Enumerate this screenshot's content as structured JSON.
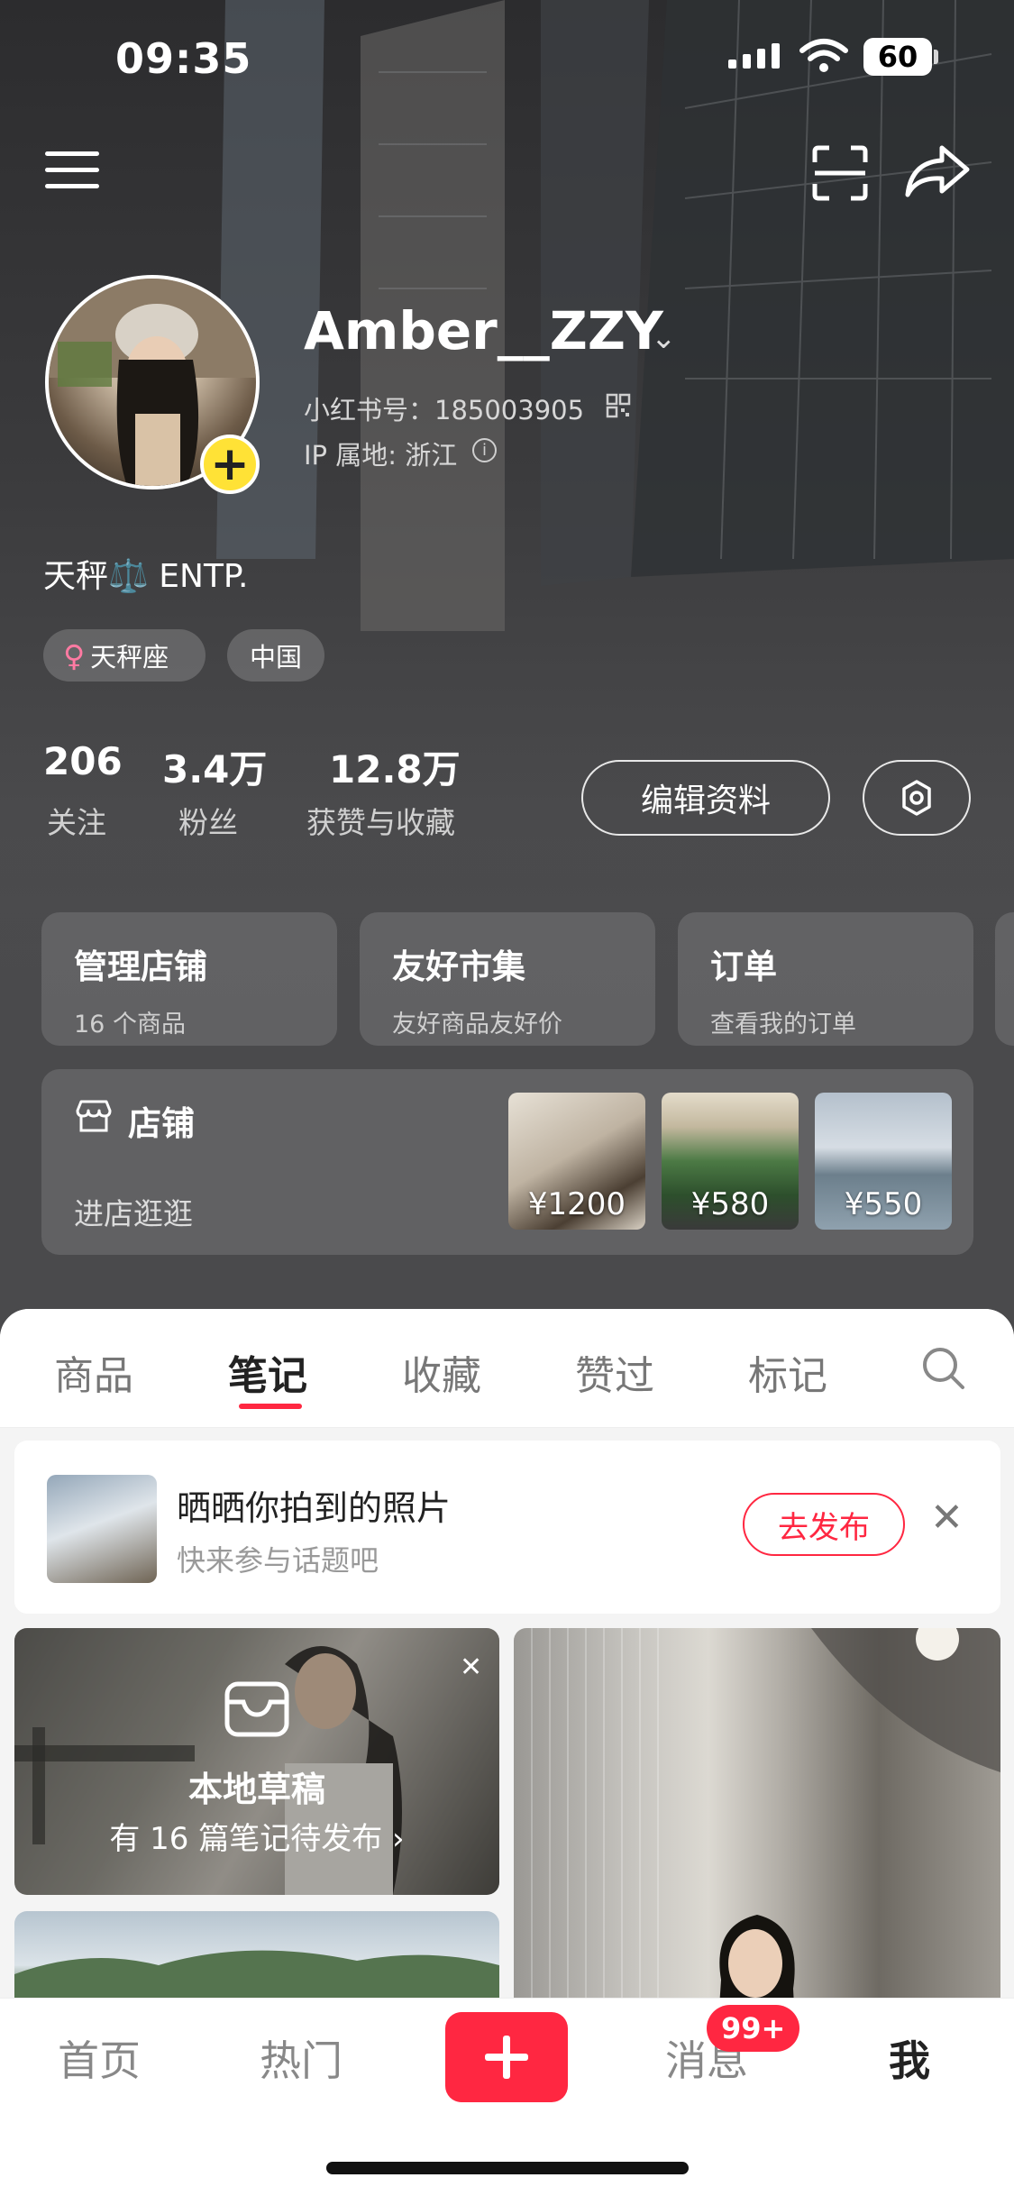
{
  "status_bar": {
    "time": "09:35",
    "battery": "60"
  },
  "profile": {
    "username": "Amber__ZZY",
    "red_id": "小红书号：185003905",
    "ip_location": "IP 属地: 浙江",
    "bio": "天秤⚖️ ENTP.",
    "tags": [
      "天秤座",
      "中国"
    ]
  },
  "stats": [
    {
      "value": "206",
      "label": "关注"
    },
    {
      "value": "3.4万",
      "label": "粉丝"
    },
    {
      "value": "12.8万",
      "label": "获赞与收藏"
    }
  ],
  "actions": {
    "edit_profile": "编辑资料"
  },
  "shop_cards": [
    {
      "title": "管理店铺",
      "subtitle": "16 个商品"
    },
    {
      "title": "友好市集",
      "subtitle": "友好商品友好价"
    },
    {
      "title": "订单",
      "subtitle": "查看我的订单"
    }
  ],
  "store": {
    "title": "店铺",
    "subtitle": "进店逛逛",
    "products": [
      {
        "price": "¥1200"
      },
      {
        "price": "¥580"
      },
      {
        "price": "¥550"
      }
    ]
  },
  "tabs": [
    "商品",
    "笔记",
    "收藏",
    "赞过",
    "标记"
  ],
  "active_tab": "笔记",
  "banner": {
    "title": "晒晒你拍到的照片",
    "subtitle": "快来参与话题吧",
    "button": "去发布"
  },
  "draft_card": {
    "title": "本地草稿",
    "subtitle": "有 16 篇笔记待发布 ›"
  },
  "bottom_nav": {
    "home": "首页",
    "trending": "热门",
    "messages": "消息",
    "messages_badge": "99+",
    "me": "我"
  },
  "colors": {
    "accent": "#ff2741",
    "avatar_badge": "#ffe236"
  },
  "icons": [
    "menu-icon",
    "scan-icon",
    "share-icon",
    "qr-icon",
    "info-icon",
    "settings-icon",
    "store-icon",
    "search-icon",
    "close-icon",
    "drafts-box-icon",
    "plus-icon"
  ]
}
